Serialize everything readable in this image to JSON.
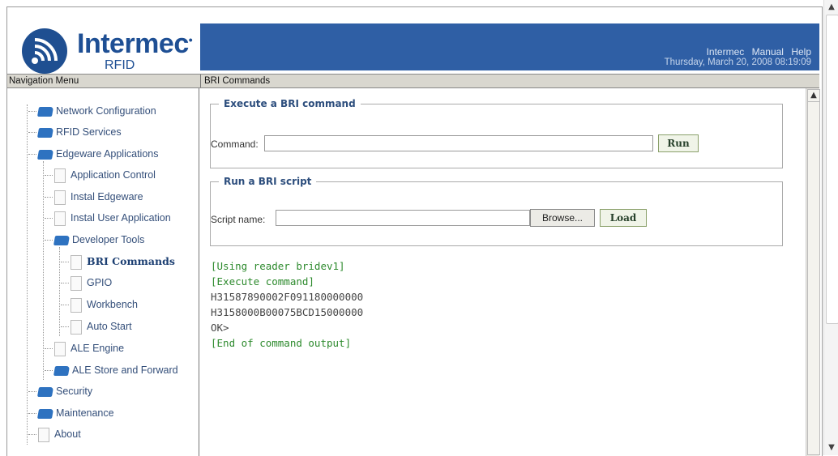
{
  "header": {
    "brand": "Intermec",
    "brand_sub": "RFID",
    "links": [
      "Intermec",
      "Manual",
      "Help"
    ],
    "datetime": "Thursday, March 20, 2008 08:19:09"
  },
  "titlebar": {
    "nav_title": "Navigation Menu",
    "page_title": "BRI Commands"
  },
  "nav": {
    "items": [
      {
        "label": "Network Configuration",
        "icon": "folder-icon"
      },
      {
        "label": "RFID Services",
        "icon": "folder-icon"
      },
      {
        "label": "Edgeware Applications",
        "icon": "folder-icon"
      },
      {
        "label": "Application Control",
        "icon": "document-icon"
      },
      {
        "label": "Instal Edgeware",
        "icon": "document-icon"
      },
      {
        "label": "Instal User Application",
        "icon": "document-icon"
      },
      {
        "label": "Developer Tools",
        "icon": "folder-icon"
      },
      {
        "label": "BRI Commands",
        "icon": "document-icon"
      },
      {
        "label": "GPIO",
        "icon": "document-icon"
      },
      {
        "label": "Workbench",
        "icon": "document-icon"
      },
      {
        "label": "Auto Start",
        "icon": "document-icon"
      },
      {
        "label": "ALE Engine",
        "icon": "document-icon"
      },
      {
        "label": "ALE Store and Forward",
        "icon": "folder-icon"
      },
      {
        "label": "Security",
        "icon": "folder-icon"
      },
      {
        "label": "Maintenance",
        "icon": "folder-icon"
      },
      {
        "label": "About",
        "icon": "document-icon"
      }
    ]
  },
  "execute": {
    "legend": "Execute a BRI command",
    "label": "Command:",
    "value": "",
    "button": "Run"
  },
  "script": {
    "legend": "Run a BRI script",
    "label": "Script name:",
    "value": "",
    "browse": "Browse...",
    "button": "Load"
  },
  "output": {
    "lines": [
      "[Using reader bridev1]",
      "[Execute command]",
      "H31587890002F091180000000",
      "H3158000B00075BCD15000000",
      "OK>",
      "[End of command output]"
    ]
  }
}
